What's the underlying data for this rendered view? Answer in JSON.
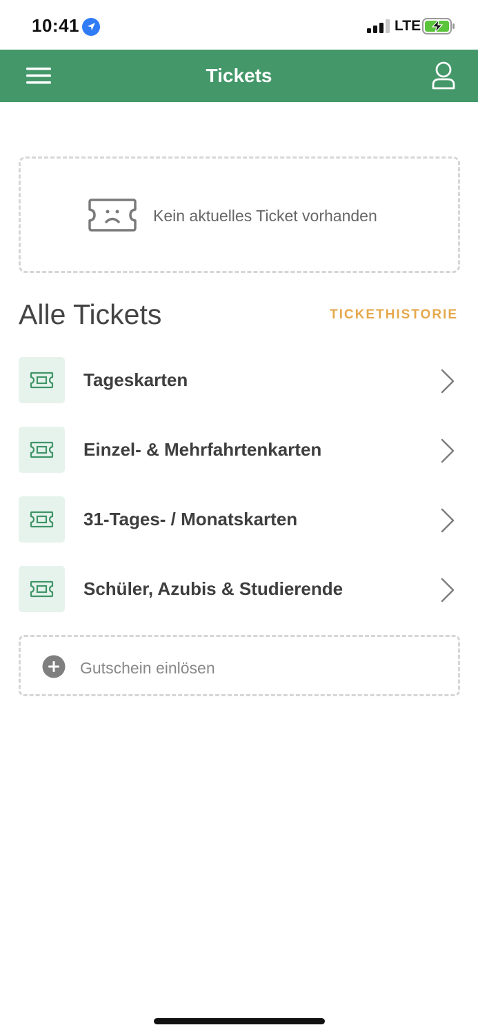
{
  "status_bar": {
    "time": "10:41",
    "network": "LTE",
    "location_icon": "location-arrow-icon",
    "signal_icon": "cellular-signal-icon",
    "battery_icon": "battery-charging-icon",
    "battery_color": "#5ac43a"
  },
  "app_bar": {
    "title": "Tickets",
    "background_color": "#439769",
    "menu_icon": "hamburger-menu-icon",
    "profile_icon": "user-profile-icon"
  },
  "current_ticket": {
    "empty_text": "Kein aktuelles Ticket vorhanden",
    "icon": "sad-ticket-icon"
  },
  "all_tickets": {
    "title": "Alle Tickets",
    "history_link": "TICKETHISTORIE",
    "history_color": "#e6a84c",
    "categories": [
      {
        "label": "Tageskarten",
        "icon": "ticket-icon"
      },
      {
        "label": "Einzel- & Mehrfahrtenkarten",
        "icon": "ticket-icon"
      },
      {
        "label": "31-Tages- / Monatskarten",
        "icon": "ticket-icon"
      },
      {
        "label": "Schüler, Azubis & Studierende",
        "icon": "ticket-icon"
      }
    ]
  },
  "voucher": {
    "label": "Gutschein einlösen",
    "icon": "plus-circle-icon"
  }
}
